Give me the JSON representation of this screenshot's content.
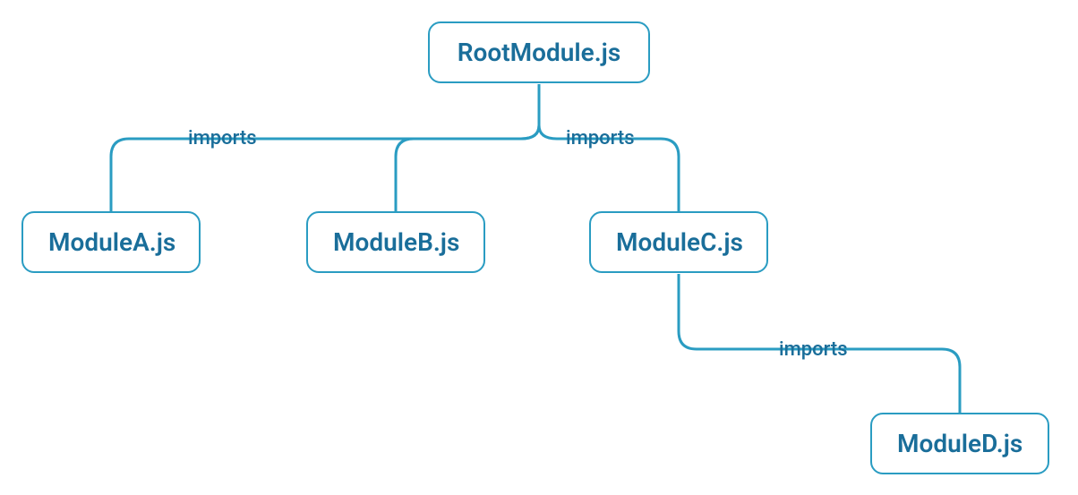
{
  "nodes": {
    "root": {
      "label": "RootModule.js"
    },
    "moduleA": {
      "label": "ModuleA.js"
    },
    "moduleB": {
      "label": "ModuleB.js"
    },
    "moduleC": {
      "label": "ModuleC.js"
    },
    "moduleD": {
      "label": "ModuleD.js"
    }
  },
  "edgeLabels": {
    "rootImports1": "imports",
    "rootImports2": "imports",
    "cImports": "imports"
  }
}
